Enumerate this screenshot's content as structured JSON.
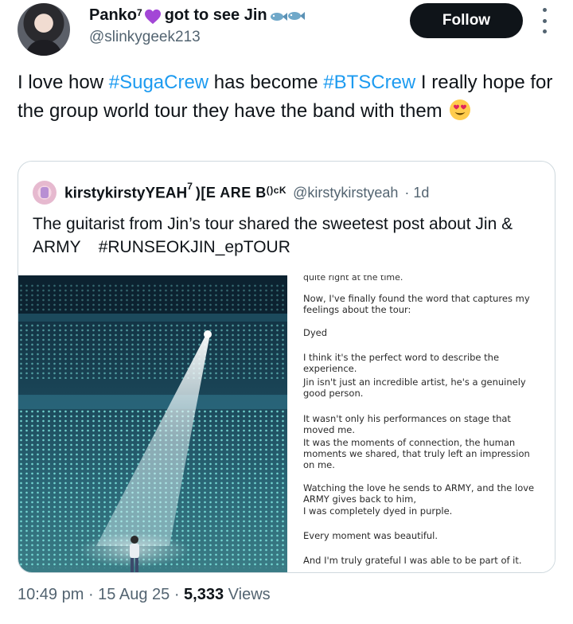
{
  "author": {
    "display_name": "Panko",
    "superscript": "7",
    "name_suffix": "got to see Jin",
    "handle": "@slinkygeek213"
  },
  "follow_label": "Follow",
  "tweet": {
    "part1": "I love how ",
    "hashtag1": "#SugaCrew",
    "part2": " has become ",
    "hashtag2": "#BTSCrew",
    "part3": " I really hope for the group world tour they have the band with them"
  },
  "quote": {
    "display_name": "kirstykirstyYEAH",
    "superscript": "7",
    "deco_a": ")[E ARE B",
    "deco_b": "()",
    "deco_c": "cK",
    "handle": "@kirstykirstyeah",
    "age": "· 1d",
    "text": "The guitarist from Jin’s tour shared the sweetest post about Jin & ARMY",
    "hashtag": "#RUNSEOKJIN_epTOUR",
    "document": {
      "cut_line": "quite right at the time.",
      "paragraphs": [
        "Now, I've finally found the word that captures my feelings about the tour:",
        "Dyed",
        "I think it's the perfect word to describe the experience.",
        "Jin isn't just an incredible artist, he's a genuinely good person.",
        "It wasn't only his performances on stage that moved me.",
        "It was the moments of connection, the human moments we shared, that truly left an impression on me.",
        "Watching the love he sends to ARMY, and the love ARMY gives back to him,",
        "I was completely dyed in purple.",
        "Every moment was beautiful.",
        "And I'm truly grateful I was able to be part of it."
      ]
    }
  },
  "meta": {
    "time": "10:49 pm",
    "date": "15 Aug 25",
    "views_count": "5,333",
    "views_label": "Views"
  },
  "icons": {
    "heart": "purple-heart-icon",
    "fish": "fish-icon",
    "emoji": "heart-eyes-emoji-icon",
    "more": "more-vertical-icon"
  },
  "colors": {
    "accent": "#1d9bf0",
    "text": "#0f1419",
    "muted": "#536471",
    "border": "#cfd9de",
    "heart": "#a347d6"
  }
}
